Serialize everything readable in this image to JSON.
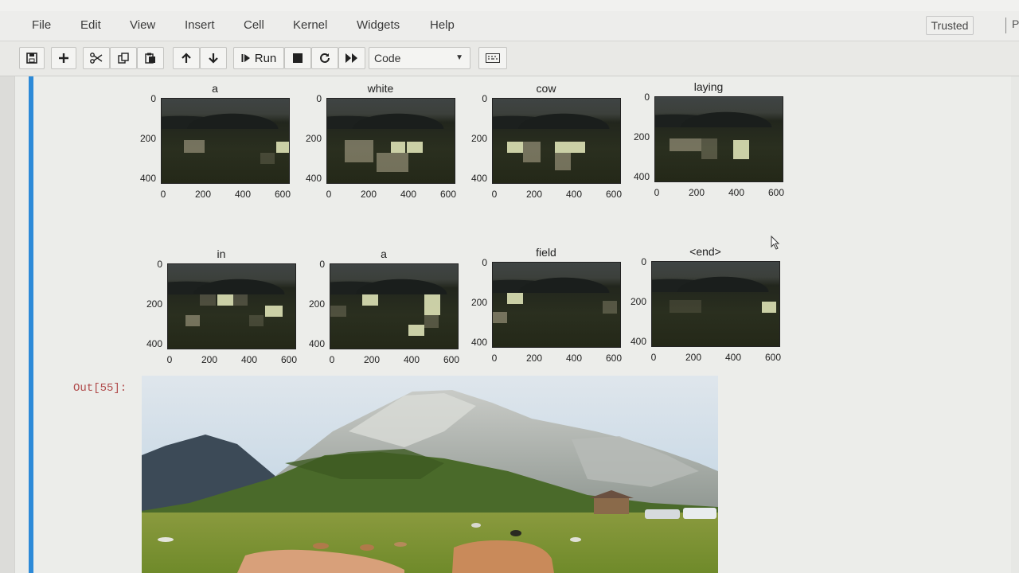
{
  "menu": {
    "items": [
      "File",
      "Edit",
      "View",
      "Insert",
      "Cell",
      "Kernel",
      "Widgets",
      "Help"
    ],
    "trusted": "Trusted",
    "kernel_indicator": "P"
  },
  "toolbar": {
    "run_label": "Run",
    "cell_type": "Code",
    "buttons": [
      "save-icon",
      "plus-icon",
      "cut-icon",
      "copy-icon",
      "paste-icon",
      "arrow-up-icon",
      "arrow-down-icon",
      "run-icon",
      "stop-icon",
      "restart-icon",
      "fast-forward-icon",
      "keyboard-icon"
    ]
  },
  "attention_plots": [
    {
      "title": "a",
      "yticks": [
        "0",
        "200",
        "400"
      ],
      "xticks": [
        "0",
        "200",
        "400",
        "600"
      ]
    },
    {
      "title": "white",
      "yticks": [
        "0",
        "200",
        "400"
      ],
      "xticks": [
        "0",
        "200",
        "400",
        "600"
      ]
    },
    {
      "title": "cow",
      "yticks": [
        "0",
        "200",
        "400"
      ],
      "xticks": [
        "0",
        "200",
        "400",
        "600"
      ]
    },
    {
      "title": "laying",
      "yticks": [
        "0",
        "200",
        "400"
      ],
      "xticks": [
        "0",
        "200",
        "400",
        "600"
      ]
    },
    {
      "title": "in",
      "yticks": [
        "0",
        "200",
        "400"
      ],
      "xticks": [
        "0",
        "200",
        "400",
        "600"
      ]
    },
    {
      "title": "a",
      "yticks": [
        "0",
        "200",
        "400"
      ],
      "xticks": [
        "0",
        "200",
        "400",
        "600"
      ]
    },
    {
      "title": "field",
      "yticks": [
        "0",
        "200",
        "400"
      ],
      "xticks": [
        "0",
        "200",
        "400",
        "600"
      ]
    },
    {
      "title": "<end>",
      "yticks": [
        "0",
        "200",
        "400"
      ],
      "xticks": [
        "0",
        "200",
        "400",
        "600"
      ]
    }
  ],
  "output": {
    "label": "Out[55]:",
    "image_subject": "cows-in-mountain-field-photo"
  },
  "colors": {
    "cell_accent": "#2c8ad8",
    "out_label": "#b04a4a"
  }
}
